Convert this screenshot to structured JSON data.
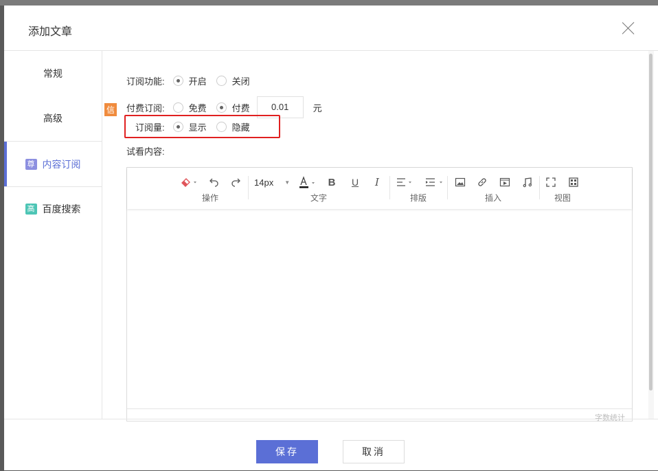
{
  "dialog": {
    "title": "添加文章"
  },
  "sidebar": {
    "items": [
      {
        "label": "常规",
        "tag": ""
      },
      {
        "label": "高级",
        "tag": ""
      },
      {
        "label": "内容订阅",
        "tag": "尊"
      },
      {
        "label": "百度搜索",
        "tag": "高"
      }
    ]
  },
  "form": {
    "subscribe": {
      "label": "订阅功能:",
      "options": [
        "开启",
        "关闭"
      ],
      "selected": "开启"
    },
    "paid": {
      "badge": "信",
      "label": "付费订阅:",
      "options": [
        "免费",
        "付费"
      ],
      "selected": "付费",
      "price": "0.01",
      "unit": "元"
    },
    "views": {
      "label": "订阅量:",
      "options": [
        "显示",
        "隐藏"
      ],
      "selected": "显示"
    },
    "preview": {
      "label": "试看内容:"
    }
  },
  "editor": {
    "font_size": "14px",
    "groups": [
      "操作",
      "文字",
      "排版",
      "插入",
      "视图"
    ],
    "word_count_label": "字数统计"
  },
  "footer": {
    "save": "保存",
    "cancel": "取消"
  },
  "colors": {
    "accent": "#5b6fd6",
    "highlight_box": "#e02020",
    "badge_orange": "#f08b3d"
  }
}
